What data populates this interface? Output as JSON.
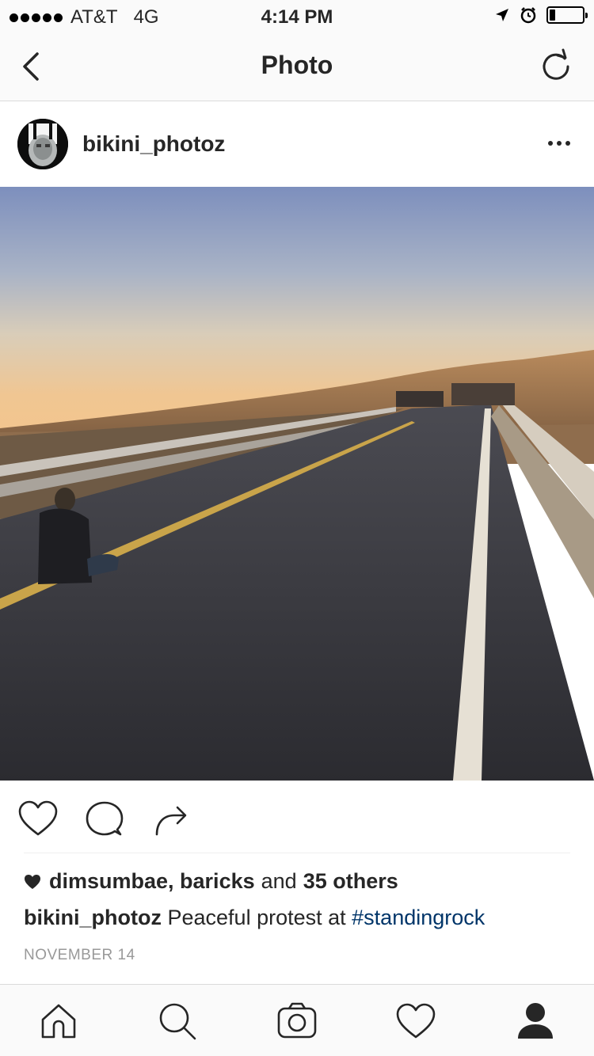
{
  "status_bar": {
    "carrier": "AT&T",
    "network": "4G",
    "time": "4:14 PM",
    "icons": [
      "signal-dots",
      "location-arrow-icon",
      "alarm-icon",
      "battery-icon"
    ]
  },
  "nav": {
    "title": "Photo",
    "back_icon": "chevron-left-icon",
    "refresh_icon": "refresh-icon"
  },
  "post": {
    "username": "bikini_photoz",
    "more_icon": "ellipsis-icon",
    "photo_description_icon": "photo",
    "likes": {
      "users": "dimsumbae, baricks",
      "connector": "and",
      "others": "35 others"
    },
    "caption": {
      "username": "bikini_photoz",
      "text": "Peaceful protest at",
      "hashtag": "#standingrock"
    },
    "date": "NOVEMBER 14"
  },
  "actions": [
    "heart-icon",
    "comment-icon",
    "share-icon"
  ],
  "tabs": [
    "home-icon",
    "search-icon",
    "camera-icon",
    "activity-heart-icon",
    "profile-icon"
  ],
  "colors": {
    "text": "#262626",
    "hashtag": "#003569",
    "muted": "#999999",
    "bar_bg": "#fafafa",
    "border": "#dbdbdb"
  }
}
